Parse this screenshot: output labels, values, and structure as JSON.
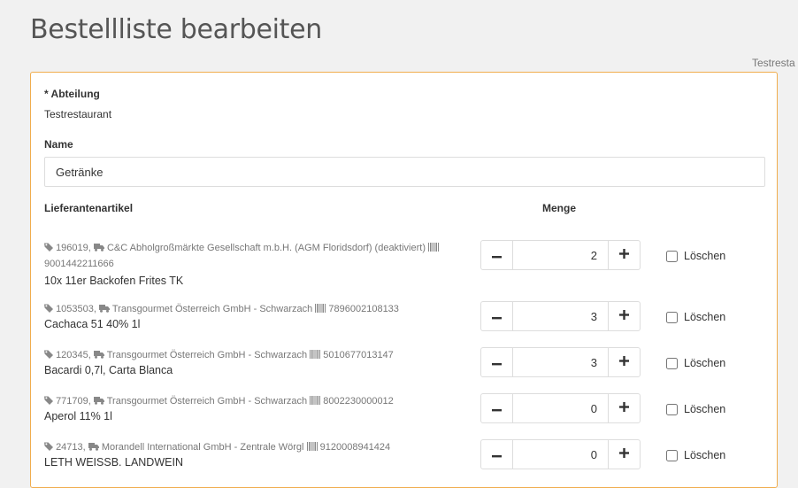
{
  "page": {
    "title": "Bestellliste bearbeiten",
    "top_right_label": "Testresta"
  },
  "form": {
    "department_label": "* Abteilung",
    "department_value": "Testrestaurant",
    "name_label": "Name",
    "name_value": "Getränke",
    "col_article": "Lieferantenartikel",
    "col_quantity": "Menge"
  },
  "items": [
    {
      "article_no": "196019,",
      "supplier": "C&C Abholgroßmärkte Gesellschaft m.b.H. (AGM Floridsdorf) (deaktiviert)",
      "barcode": "9001442211666",
      "name": "10x 11er Backofen Frites TK",
      "quantity": "2",
      "delete_label": "Löschen"
    },
    {
      "article_no": "1053503,",
      "supplier": "Transgourmet Österreich GmbH - Schwarzach",
      "barcode": "7896002108133",
      "name": "Cachaca 51 40% 1l",
      "quantity": "3",
      "delete_label": "Löschen"
    },
    {
      "article_no": "120345,",
      "supplier": "Transgourmet Österreich GmbH - Schwarzach",
      "barcode": "5010677013147",
      "name": "Bacardi 0,7l, Carta Blanca",
      "quantity": "3",
      "delete_label": "Löschen"
    },
    {
      "article_no": "771709,",
      "supplier": "Transgourmet Österreich GmbH - Schwarzach",
      "barcode": "8002230000012",
      "name": "Aperol 11% 1l",
      "quantity": "0",
      "delete_label": "Löschen"
    },
    {
      "article_no": "24713,",
      "supplier": "Morandell International GmbH - Zentrale Wörgl",
      "barcode": "9120008941424",
      "name": "LETH WEISSB. LANDWEIN",
      "quantity": "0",
      "delete_label": "Löschen"
    }
  ],
  "icons": {
    "tag": "tag-icon",
    "truck": "truck-icon",
    "barcode": "barcode-icon",
    "minus": "minus-icon",
    "plus": "plus-icon"
  },
  "colors": {
    "card_border": "#f0ad4e",
    "background": "#f1f1f1"
  }
}
